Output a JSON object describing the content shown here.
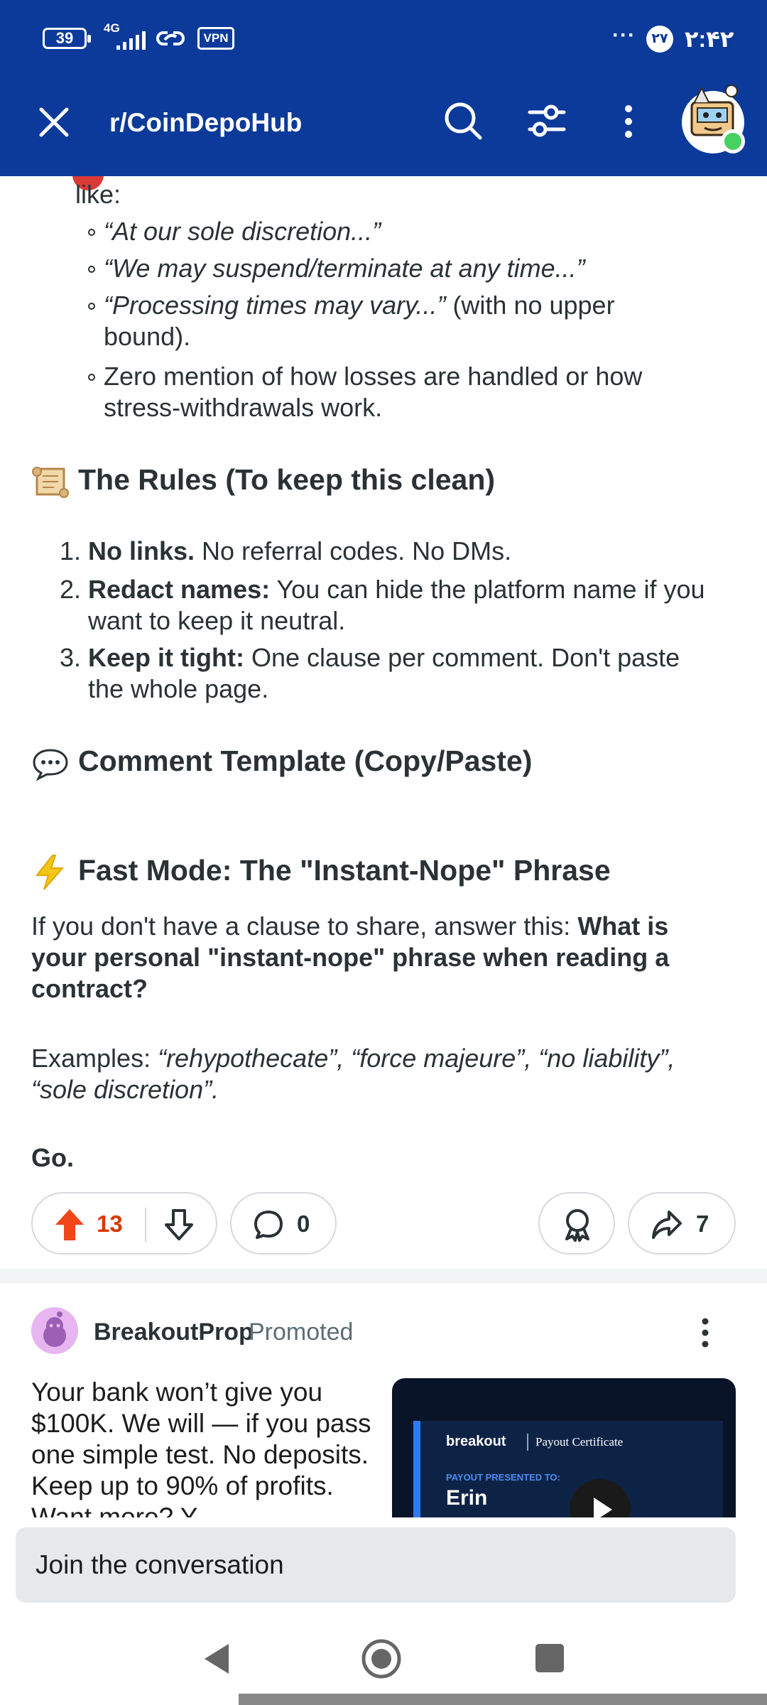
{
  "status_bar": {
    "battery": "39",
    "network": "4G",
    "vpn": "VPN",
    "more": "···",
    "badge": "۲۷",
    "time": "۲:۴۲"
  },
  "header": {
    "subreddit": "r/CoinDepoHub"
  },
  "post": {
    "intro_tail": "like:",
    "bullets": [
      "“At our sole discretion...”",
      "“We may suspend/terminate at any time...”",
      "“Processing times may vary...”",
      " (with no upper",
      "bound).",
      "Zero mention of how losses are handled or how",
      "stress-withdrawals work."
    ],
    "rules_heading": "The Rules (To keep this clean)",
    "rules": [
      {
        "num": "1.",
        "bold": "No links.",
        "text": " No referral codes. No DMs.",
        "cont": ""
      },
      {
        "num": "2.",
        "bold": "Redact names:",
        "text": " You can hide the platform name if you",
        "cont": "want to keep it neutral."
      },
      {
        "num": "3.",
        "bold": "Keep it tight:",
        "text": " One clause per comment. Don't paste",
        "cont": "the whole page."
      }
    ],
    "template_heading": "Comment Template (Copy/Paste)",
    "fast_heading": "Fast Mode: The \"Instant-Nope\" Phrase",
    "fast_line1_plain": "If you don't have a clause to share, answer this: ",
    "fast_line1_bold": "What is",
    "fast_line2": "your personal \"instant-nope\" phrase when reading a",
    "fast_line3": "contract?",
    "examples_label": "Examples: ",
    "examples_line1": "“rehypothecate”, “force majeure”, “no liability”,",
    "examples_line2": "“sole discretion”.",
    "go": "Go."
  },
  "actions": {
    "upvotes": "13",
    "comments": "0",
    "shares": "7"
  },
  "promoted": {
    "name": "BreakoutProp",
    "label": "Promoted",
    "text": "Your bank won’t give you $100K. We will — if you pass one simple test. No deposits. Keep up to 90% of profits. Want more? Y",
    "cert_brand": "breakout",
    "cert_title": "Payout Certificate",
    "cert_label": "PAYOUT PRESENTED TO:",
    "cert_name": "Erin"
  },
  "composer": {
    "placeholder": "Join the conversation"
  },
  "colors": {
    "header_bg": "#0c3a9a",
    "upvote": "#d93900",
    "online": "#46d160"
  }
}
